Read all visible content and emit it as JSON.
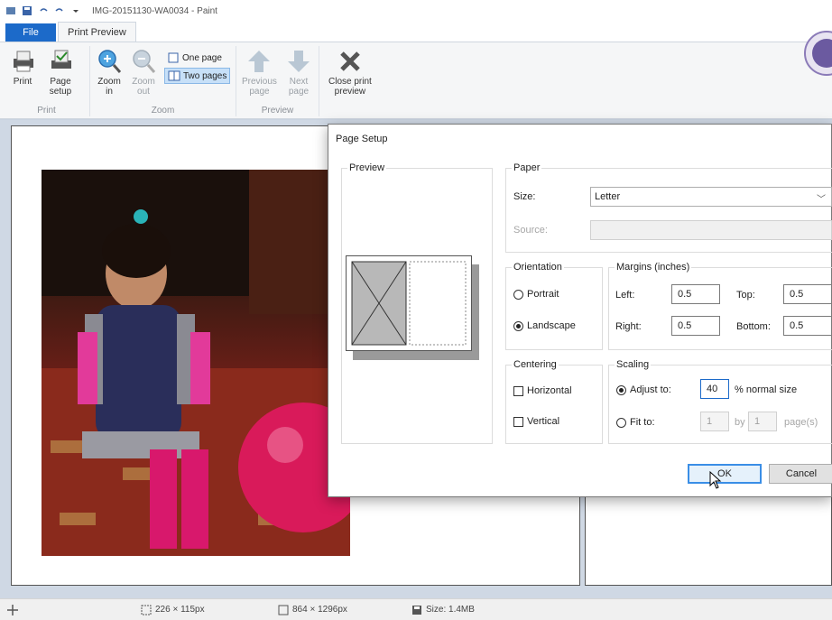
{
  "window": {
    "title": "IMG-20151130-WA0034 - Paint"
  },
  "tabs": {
    "file": "File",
    "print_preview": "Print Preview"
  },
  "ribbon": {
    "print_group": {
      "label": "Print",
      "print": "Print",
      "page_setup": "Page\nsetup"
    },
    "zoom_group": {
      "label": "Zoom",
      "zoom_in": "Zoom\nin",
      "zoom_out": "Zoom\nout",
      "one_page": "One page",
      "two_pages": "Two pages"
    },
    "preview_group": {
      "label": "Preview",
      "previous_page": "Previous\npage",
      "next_page": "Next\npage"
    },
    "close_preview": "Close print\npreview"
  },
  "dialog": {
    "title": "Page Setup",
    "preview_legend": "Preview",
    "paper_legend": "Paper",
    "size_label": "Size:",
    "size_value": "Letter",
    "source_label": "Source:",
    "source_value": "",
    "orientation_legend": "Orientation",
    "portrait": "Portrait",
    "landscape": "Landscape",
    "orientation_selected": "landscape",
    "margins_legend": "Margins (inches)",
    "left_label": "Left:",
    "left_value": "0.5",
    "top_label": "Top:",
    "top_value": "0.5",
    "right_label": "Right:",
    "right_value": "0.5",
    "bottom_label": "Bottom:",
    "bottom_value": "0.5",
    "centering_legend": "Centering",
    "horizontal": "Horizontal",
    "vertical": "Vertical",
    "scaling_legend": "Scaling",
    "adjust_to": "Adjust to:",
    "adjust_value": "40",
    "normal_size": "% normal size",
    "fit_to": "Fit to:",
    "fit_w": "1",
    "by": "by",
    "fit_h": "1",
    "pages": "page(s)",
    "ok": "OK",
    "cancel": "Cancel"
  },
  "statusbar": {
    "selection_size": "226 × 115px",
    "image_size": "864 × 1296px",
    "file_size": "Size: 1.4MB"
  },
  "colors": {
    "accent": "#1c6ac9",
    "ribbon_bg": "#f5f6f7",
    "canvas_bg": "#cfd8e4"
  }
}
